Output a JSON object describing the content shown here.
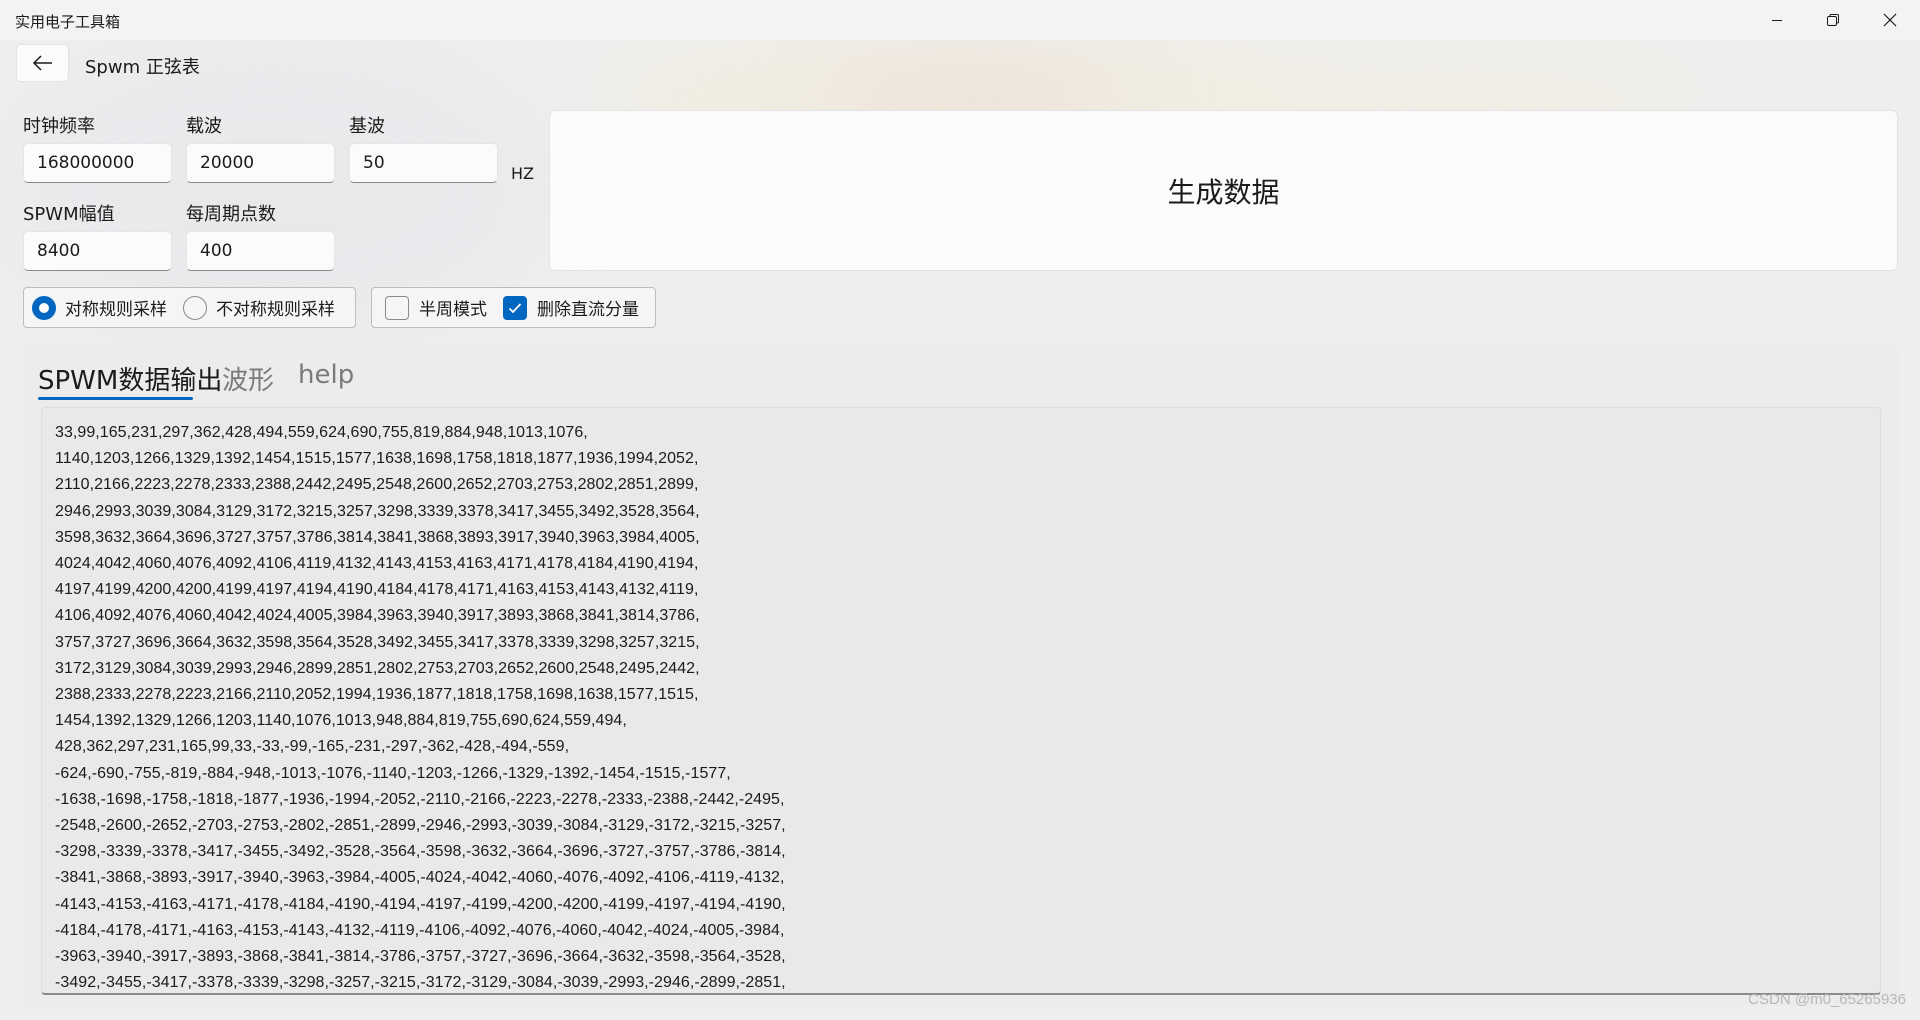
{
  "window": {
    "title": "实用电子工具箱",
    "controls": [
      "minimize",
      "restore",
      "close"
    ]
  },
  "header": {
    "back_icon": "arrow-left-icon",
    "page_title": "Spwm 正弦表"
  },
  "form": {
    "clock_label": "时钟频率",
    "clock_value": "168000000",
    "carrier_label": "载波",
    "carrier_value": "20000",
    "fundamental_label": "基波",
    "fundamental_value": "50",
    "unit": "HZ",
    "amplitude_label": "SPWM幅值",
    "amplitude_value": "8400",
    "points_label": "每周期点数",
    "points_value": "400"
  },
  "generate_button": "生成数据",
  "sampling": {
    "symmetric": "对称规则采样",
    "symmetric_selected": true,
    "asymmetric": "不对称规则采样",
    "asymmetric_selected": false
  },
  "options": {
    "half_cycle": "半周模式",
    "half_cycle_checked": false,
    "remove_dc": "删除直流分量",
    "remove_dc_checked": true
  },
  "tabs": [
    {
      "label": "SPWM数据输出",
      "active": true
    },
    {
      "label": "波形",
      "active": false
    },
    {
      "label": "help",
      "active": false
    }
  ],
  "output_lines": [
    "33,99,165,231,297,362,428,494,559,624,690,755,819,884,948,1013,1076,",
    "1140,1203,1266,1329,1392,1454,1515,1577,1638,1698,1758,1818,1877,1936,1994,2052,",
    "2110,2166,2223,2278,2333,2388,2442,2495,2548,2600,2652,2703,2753,2802,2851,2899,",
    "2946,2993,3039,3084,3129,3172,3215,3257,3298,3339,3378,3417,3455,3492,3528,3564,",
    "3598,3632,3664,3696,3727,3757,3786,3814,3841,3868,3893,3917,3940,3963,3984,4005,",
    "4024,4042,4060,4076,4092,4106,4119,4132,4143,4153,4163,4171,4178,4184,4190,4194,",
    "4197,4199,4200,4200,4199,4197,4194,4190,4184,4178,4171,4163,4153,4143,4132,4119,",
    "4106,4092,4076,4060,4042,4024,4005,3984,3963,3940,3917,3893,3868,3841,3814,3786,",
    "3757,3727,3696,3664,3632,3598,3564,3528,3492,3455,3417,3378,3339,3298,3257,3215,",
    "3172,3129,3084,3039,2993,2946,2899,2851,2802,2753,2703,2652,2600,2548,2495,2442,",
    "2388,2333,2278,2223,2166,2110,2052,1994,1936,1877,1818,1758,1698,1638,1577,1515,",
    "1454,1392,1329,1266,1203,1140,1076,1013,948,884,819,755,690,624,559,494,",
    "428,362,297,231,165,99,33,-33,-99,-165,-231,-297,-362,-428,-494,-559,",
    "-624,-690,-755,-819,-884,-948,-1013,-1076,-1140,-1203,-1266,-1329,-1392,-1454,-1515,-1577,",
    "-1638,-1698,-1758,-1818,-1877,-1936,-1994,-2052,-2110,-2166,-2223,-2278,-2333,-2388,-2442,-2495,",
    "-2548,-2600,-2652,-2703,-2753,-2802,-2851,-2899,-2946,-2993,-3039,-3084,-3129,-3172,-3215,-3257,",
    "-3298,-3339,-3378,-3417,-3455,-3492,-3528,-3564,-3598,-3632,-3664,-3696,-3727,-3757,-3786,-3814,",
    "-3841,-3868,-3893,-3917,-3940,-3963,-3984,-4005,-4024,-4042,-4060,-4076,-4092,-4106,-4119,-4132,",
    "-4143,-4153,-4163,-4171,-4178,-4184,-4190,-4194,-4197,-4199,-4200,-4200,-4199,-4197,-4194,-4190,",
    "-4184,-4178,-4171,-4163,-4153,-4143,-4132,-4119,-4106,-4092,-4076,-4060,-4042,-4024,-4005,-3984,",
    "-3963,-3940,-3917,-3893,-3868,-3841,-3814,-3786,-3757,-3727,-3696,-3664,-3632,-3598,-3564,-3528,",
    "-3492,-3455,-3417,-3378,-3339,-3298,-3257,-3215,-3172,-3129,-3084,-3039,-2993,-2946,-2899,-2851,"
  ],
  "watermark": "CSDN @m0_65265936",
  "colors": {
    "accent": "#0067c0",
    "background": "#eeeeee"
  }
}
